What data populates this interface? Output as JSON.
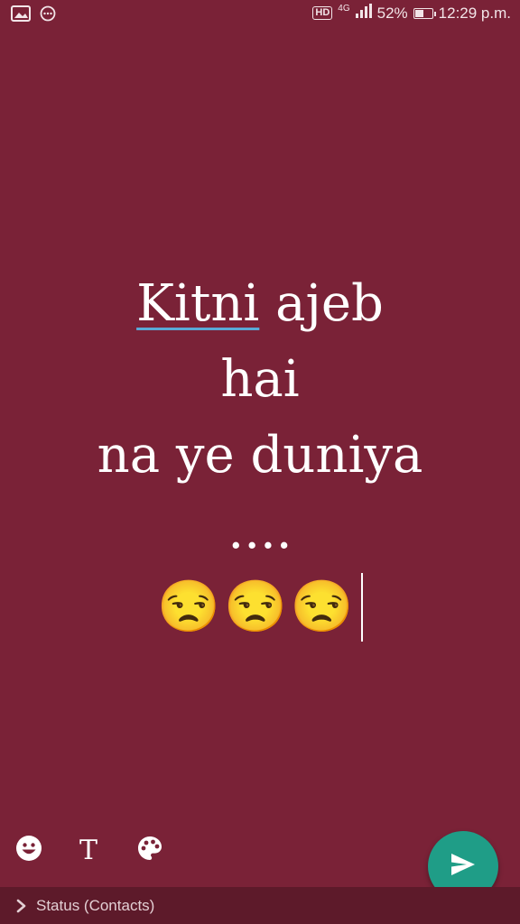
{
  "status_bar": {
    "battery_percent_label": "52%",
    "battery_level": 0.52,
    "time": "12:29 p.m.",
    "hd_badge": "HD",
    "network_label": "4G",
    "left_icons": [
      "image-icon",
      "more-circle-icon"
    ]
  },
  "status_text": {
    "lines": [
      "Kitni",
      "ajeb",
      "hai",
      "na ye duniya",
      "...."
    ],
    "emoji": [
      "😒",
      "😒",
      "😒"
    ],
    "text_color": "#ffffff",
    "spell_underline_color": "#5aa9d6"
  },
  "toolbar": {
    "text_tool_label": "T",
    "icons": [
      "emoji-icon",
      "text-icon",
      "palette-icon"
    ]
  },
  "send_button": {
    "color": "#1f9d87",
    "icon": "send-icon"
  },
  "bottom_bar": {
    "audience_label": "Status (Contacts)",
    "icon": "chevron-right-icon"
  },
  "colors": {
    "background": "#7a2237",
    "bottom_bar": "#5d1a2a"
  }
}
